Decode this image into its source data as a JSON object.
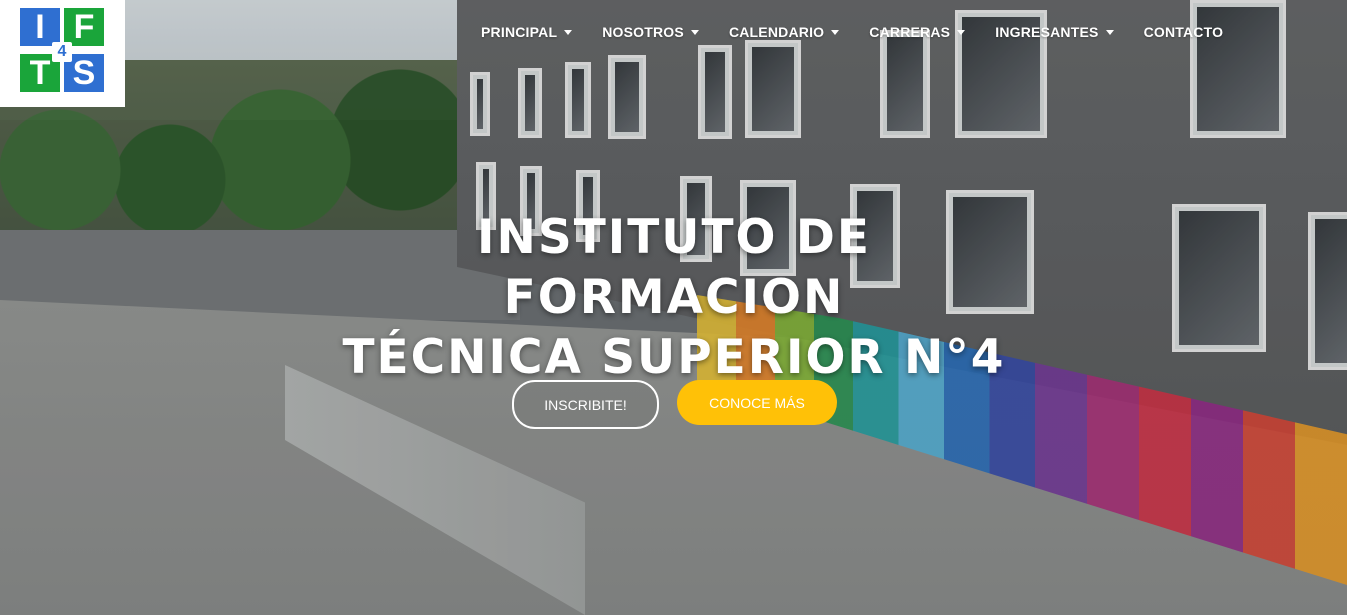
{
  "logo": {
    "letters": [
      "I",
      "F",
      "T",
      "S"
    ],
    "number": "4",
    "colors": {
      "blue": "#2f6fd1",
      "green": "#1aa53a"
    }
  },
  "nav": {
    "items": [
      {
        "label": "PRINCIPAL",
        "dropdown": true
      },
      {
        "label": "NOSOTROS",
        "dropdown": true
      },
      {
        "label": "CALENDARIO",
        "dropdown": true
      },
      {
        "label": "CARRERAS",
        "dropdown": true
      },
      {
        "label": "INGRESANTES",
        "dropdown": true
      },
      {
        "label": "CONTACTO",
        "dropdown": false
      }
    ]
  },
  "hero": {
    "title_line1": "INSTITUTO DE FORMACION",
    "title_line2": "TÉCNICA SUPERIOR N°4",
    "primary_button": "INSCRIBITE!",
    "secondary_button": "CONOCE MÁS",
    "accent_color": "#ffc107"
  }
}
